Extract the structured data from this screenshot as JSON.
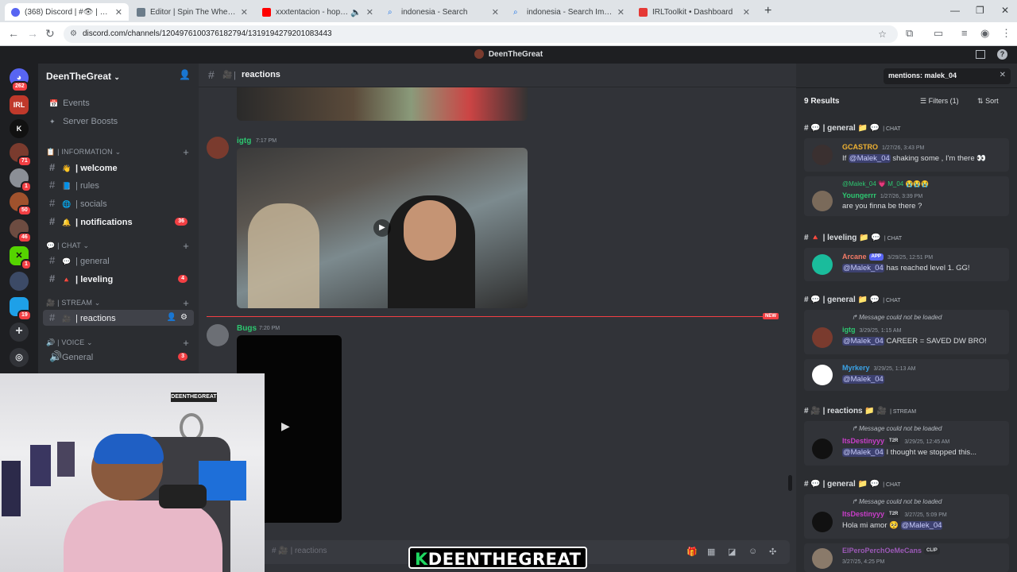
{
  "browser": {
    "tabs": [
      {
        "title": "(368) Discord | #👁 | reactions",
        "active": true
      },
      {
        "title": "Editor | Spin The Wheel - Random",
        "active": false
      },
      {
        "title": "xxxtentacion - hope ( slowed",
        "active": false
      },
      {
        "title": "indonesia - Search",
        "active": false
      },
      {
        "title": "indonesia - Search Images",
        "active": false
      },
      {
        "title": "IRLToolkit • Dashboard",
        "active": false
      }
    ],
    "url": "discord.com/channels/1204976100376182794/1319194279201083443",
    "new_tab": "+",
    "win_min": "—",
    "win_max": "❐",
    "win_close": "✕"
  },
  "discord": {
    "window_title": "DeenTheGreat",
    "server_badges": {
      "home": "262",
      "s4": "71",
      "s5": "1",
      "s6": "50",
      "s7": "46",
      "s8": "1",
      "s10": "19"
    },
    "server_name": "DeenTheGreat",
    "sidebar_top": [
      {
        "label": "Events",
        "icon": "📅"
      },
      {
        "label": "Server Boosts",
        "icon": "✦"
      }
    ],
    "categories": {
      "information": "📋 | INFORMATION ⌄",
      "chat": "💬 | CHAT ⌄",
      "stream": "🎥 | STREAM ⌄",
      "voice": "🔊 | VOICE ⌄"
    },
    "channels": {
      "welcome": {
        "emoji": "👋",
        "label": "welcome"
      },
      "rules": {
        "emoji": "📘",
        "label": "rules"
      },
      "socials": {
        "emoji": "🌐",
        "label": "socials"
      },
      "notifications": {
        "emoji": "🔔",
        "label": "notifications",
        "badge": "36"
      },
      "general": {
        "emoji": "💬",
        "label": "general"
      },
      "leveling": {
        "emoji": "🔺",
        "label": "leveling",
        "badge": "4"
      },
      "reactions": {
        "emoji": "🎥",
        "label": "reactions"
      },
      "voice_general": {
        "label": "General",
        "badge": "3"
      }
    },
    "chat_header": {
      "channel": "reactions",
      "prefix": "# 🎥 |"
    },
    "messages": [
      {
        "author": "igtg",
        "time": "7:17 PM",
        "color": "#2dc770"
      },
      {
        "author": "Bugs",
        "time": "7:20 PM",
        "color": "#2dc770"
      }
    ],
    "new_label": "NEW",
    "composer_placeholder": "# 🎥 | reactions",
    "search": {
      "query": "mentions: malek_04",
      "results_count": "9 Results",
      "filters": "Filters (1)",
      "sort": "Sort"
    },
    "results": [
      {
        "channel": "general",
        "category": "CHAT",
        "items": [
          {
            "author": "GCASTRO",
            "time": "1/27/26, 3:43 PM",
            "mention": "@Malek_04",
            "text": " shaking some , I'm there 👀",
            "color": "#f0b232"
          },
          {
            "author": "Youngerrr",
            "time": "1/27/26, 3:39 PM",
            "reply": "@Malek_04 💗 M_04 😭😭😭",
            "text": "are you finna be there ?",
            "color": "#2dc770"
          }
        ]
      },
      {
        "channel": "leveling",
        "category": "CHAT",
        "items": [
          {
            "author": "Arcane",
            "tag": "APP",
            "time": "3/29/25, 12:51 PM",
            "mention": "@Malek_04",
            "text": " has reached level 1. GG!",
            "color": "#f47b67"
          }
        ]
      },
      {
        "channel": "general",
        "category": "CHAT",
        "items": [
          {
            "author": "igtg",
            "time": "3/29/25, 1:15 AM",
            "notloaded": "Message could not be loaded",
            "mention": "@Malek_04",
            "text": " CAREER = SAVED DW BRO!",
            "color": "#2dc770"
          },
          {
            "author": "Myrkery",
            "time": "3/29/25, 1:13 AM",
            "mention": "@Malek_04",
            "text": "",
            "color": "#3ba4e8"
          }
        ]
      },
      {
        "channel": "reactions",
        "category": "STREAM",
        "items": [
          {
            "author": "ItsDestinyyy",
            "tag": "T2R",
            "time": "3/29/25, 12:45 AM",
            "notloaded": "Message could not be loaded",
            "mention": "@Malek_04",
            "text": " I thought we stopped this...",
            "color": "#c93ec9"
          }
        ]
      },
      {
        "channel": "general",
        "category": "CHAT",
        "items": [
          {
            "author": "ItsDestinyyy",
            "tag": "T2R",
            "time": "3/27/25, 5:09 PM",
            "notloaded": "Message could not be loaded",
            "pre": "Hola mi amor 🥺 ",
            "mention": "@Malek_04",
            "text": "",
            "color": "#c93ec9"
          },
          {
            "author": "ElPeroPerchOeMeCans",
            "tag": "CLIP",
            "time": "3/27/25, 4:25 PM",
            "text": "",
            "color": "#9b59b6"
          }
        ]
      }
    ]
  },
  "stream_overlay": {
    "k": "K",
    "name": "DEENTHEGREAT"
  },
  "webcam_banner": "DEENTHEGREAT"
}
